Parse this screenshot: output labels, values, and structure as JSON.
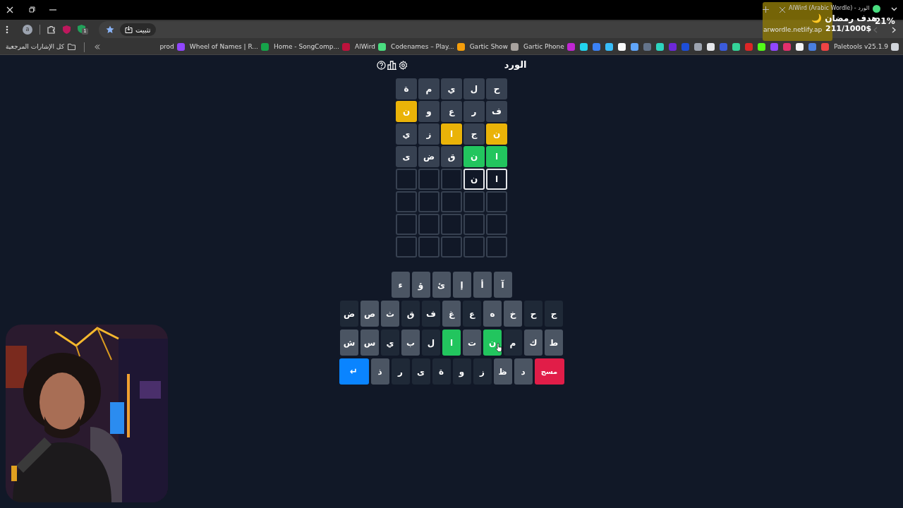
{
  "browser": {
    "tab_title": "AlWird (Arabic Wordle) - الورد",
    "profile_initial": "a",
    "extension_badge": "1",
    "install_button": "تثبيت",
    "url": "arwordle.netlify.ap",
    "all_bookmarks": "كل الإشارات المرجعية",
    "bookmarks": [
      {
        "kind": "link",
        "label": "Paletools v25.1.9",
        "color": "#d1d5db"
      },
      {
        "kind": "icon",
        "color": "#ef4444"
      },
      {
        "kind": "icon",
        "color": "#4a7fe0"
      },
      {
        "kind": "icon",
        "color": "#f3f4f6"
      },
      {
        "kind": "icon",
        "color": "#e1306c"
      },
      {
        "kind": "icon",
        "color": "#9146ff"
      },
      {
        "kind": "icon",
        "color": "#53fc18"
      },
      {
        "kind": "icon",
        "color": "#dc2626"
      },
      {
        "kind": "icon",
        "color": "#34d399"
      },
      {
        "kind": "icon",
        "color": "#3b5bdb"
      },
      {
        "kind": "icon",
        "color": "#e5e7eb"
      },
      {
        "kind": "icon",
        "color": "#9ca3af"
      },
      {
        "kind": "icon",
        "color": "#1d4ed8"
      },
      {
        "kind": "icon",
        "color": "#6d28d9"
      },
      {
        "kind": "icon",
        "color": "#2dd4bf"
      },
      {
        "kind": "icon",
        "color": "#64748b"
      },
      {
        "kind": "icon",
        "color": "#60a5fa"
      },
      {
        "kind": "icon",
        "color": "#f9fafb"
      },
      {
        "kind": "icon",
        "color": "#38bdf8"
      },
      {
        "kind": "icon",
        "color": "#3b82f6"
      },
      {
        "kind": "icon",
        "color": "#22d3ee"
      },
      {
        "kind": "link",
        "label": "Gartic Phone",
        "color": "#c026d3"
      },
      {
        "kind": "link",
        "label": "Gartic Show",
        "color": "#a8a29e"
      },
      {
        "kind": "link",
        "label": "Codenames – Play...",
        "color": "#f59e0b"
      },
      {
        "kind": "link",
        "label": "AlWird",
        "color": "#4ade80"
      },
      {
        "kind": "link",
        "label": "Home - SongComp...",
        "color": "#be123c"
      },
      {
        "kind": "link",
        "label": "Wheel of Names | R...",
        "color": "#16a34a"
      },
      {
        "kind": "link",
        "label": "prod",
        "color": "#9146ff"
      }
    ]
  },
  "stream_overlay": {
    "title": "هدف رمضان 🌙",
    "amount": "211/1000$",
    "percent": "21%"
  },
  "game": {
    "title": "الورد",
    "board": [
      [
        {
          "letter": "ح",
          "kind": "absent"
        },
        {
          "letter": "ل",
          "kind": "absent"
        },
        {
          "letter": "ي",
          "kind": "absent"
        },
        {
          "letter": "م",
          "kind": "absent"
        },
        {
          "letter": "ة",
          "kind": "absent"
        }
      ],
      [
        {
          "letter": "ف",
          "kind": "absent"
        },
        {
          "letter": "ر",
          "kind": "absent"
        },
        {
          "letter": "ع",
          "kind": "absent"
        },
        {
          "letter": "و",
          "kind": "absent"
        },
        {
          "letter": "ن",
          "kind": "present"
        }
      ],
      [
        {
          "letter": "ن",
          "kind": "present"
        },
        {
          "letter": "ج",
          "kind": "absent"
        },
        {
          "letter": "ا",
          "kind": "present"
        },
        {
          "letter": "ز",
          "kind": "absent"
        },
        {
          "letter": "ي",
          "kind": "absent"
        }
      ],
      [
        {
          "letter": "ا",
          "kind": "correct"
        },
        {
          "letter": "ن",
          "kind": "correct"
        },
        {
          "letter": "ق",
          "kind": "absent"
        },
        {
          "letter": "ض",
          "kind": "absent"
        },
        {
          "letter": "ى",
          "kind": "absent"
        }
      ],
      [
        {
          "letter": "ا",
          "kind": "typed"
        },
        {
          "letter": "ن",
          "kind": "typed"
        },
        {
          "kind": "empty"
        },
        {
          "kind": "empty"
        },
        {
          "kind": "empty"
        }
      ],
      [
        {
          "kind": "empty"
        },
        {
          "kind": "empty"
        },
        {
          "kind": "empty"
        },
        {
          "kind": "empty"
        },
        {
          "kind": "empty"
        }
      ],
      [
        {
          "kind": "empty"
        },
        {
          "kind": "empty"
        },
        {
          "kind": "empty"
        },
        {
          "kind": "empty"
        },
        {
          "kind": "empty"
        }
      ],
      [
        {
          "kind": "empty"
        },
        {
          "kind": "empty"
        },
        {
          "kind": "empty"
        },
        {
          "kind": "empty"
        },
        {
          "kind": "empty"
        }
      ]
    ],
    "keyboard": [
      [
        {
          "kind": "unused",
          "label": "آ"
        },
        {
          "kind": "unused",
          "label": "أ"
        },
        {
          "kind": "unused",
          "label": "إ"
        },
        {
          "kind": "unused",
          "label": "ئ"
        },
        {
          "kind": "unused",
          "label": "ؤ"
        },
        {
          "kind": "unused",
          "label": "ء"
        }
      ],
      [
        {
          "kind": "absent",
          "label": "ج"
        },
        {
          "kind": "absent",
          "label": "ح"
        },
        {
          "kind": "unused",
          "label": "خ"
        },
        {
          "kind": "unused",
          "label": "ه"
        },
        {
          "kind": "absent",
          "label": "ع"
        },
        {
          "kind": "unused",
          "label": "غ"
        },
        {
          "kind": "absent",
          "label": "ف"
        },
        {
          "kind": "absent",
          "label": "ق"
        },
        {
          "kind": "unused",
          "label": "ث"
        },
        {
          "kind": "unused",
          "label": "ص"
        },
        {
          "kind": "absent",
          "label": "ض"
        }
      ],
      [
        {
          "kind": "unused",
          "label": "ط"
        },
        {
          "kind": "unused",
          "label": "ك"
        },
        {
          "kind": "absent",
          "label": "م"
        },
        {
          "kind": "correct",
          "label": "ن"
        },
        {
          "kind": "unused",
          "label": "ت"
        },
        {
          "kind": "correct",
          "label": "ا"
        },
        {
          "kind": "absent",
          "label": "ل"
        },
        {
          "kind": "unused",
          "label": "ب"
        },
        {
          "kind": "absent",
          "label": "ي"
        },
        {
          "kind": "unused",
          "label": "س"
        },
        {
          "kind": "unused",
          "label": "ش"
        }
      ],
      [
        {
          "kind": "delete",
          "label": "مسح"
        },
        {
          "kind": "unused",
          "label": "د"
        },
        {
          "kind": "unused",
          "label": "ظ"
        },
        {
          "kind": "absent",
          "label": "ز"
        },
        {
          "kind": "absent",
          "label": "و"
        },
        {
          "kind": "absent",
          "label": "ة"
        },
        {
          "kind": "absent",
          "label": "ى"
        },
        {
          "kind": "absent",
          "label": "ر"
        },
        {
          "kind": "unused",
          "label": "ذ"
        },
        {
          "kind": "enter",
          "label": "↵"
        }
      ]
    ]
  }
}
